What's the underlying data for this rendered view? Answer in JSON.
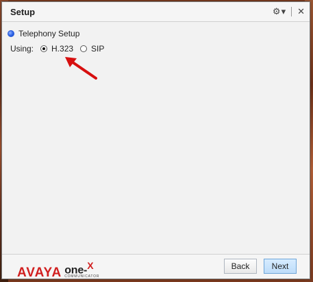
{
  "window": {
    "title": "Setup",
    "title_icons": [
      "gear-icon",
      "chevron-down-icon",
      "close-icon"
    ]
  },
  "setup": {
    "telephony_label": "Telephony Setup",
    "using_label": "Using:",
    "options": [
      {
        "label": "H.323",
        "selected": true
      },
      {
        "label": "SIP",
        "selected": false
      }
    ]
  },
  "footer": {
    "brand": "AVAYA",
    "product_main": "one-",
    "product_x": "X",
    "product_sub": "COMMUNICATOR",
    "back_label": "Back",
    "next_label": "Next"
  },
  "colors": {
    "brand": "#d11f1f",
    "arrow": "#d70f0f",
    "next_button": "#bddcf9"
  }
}
